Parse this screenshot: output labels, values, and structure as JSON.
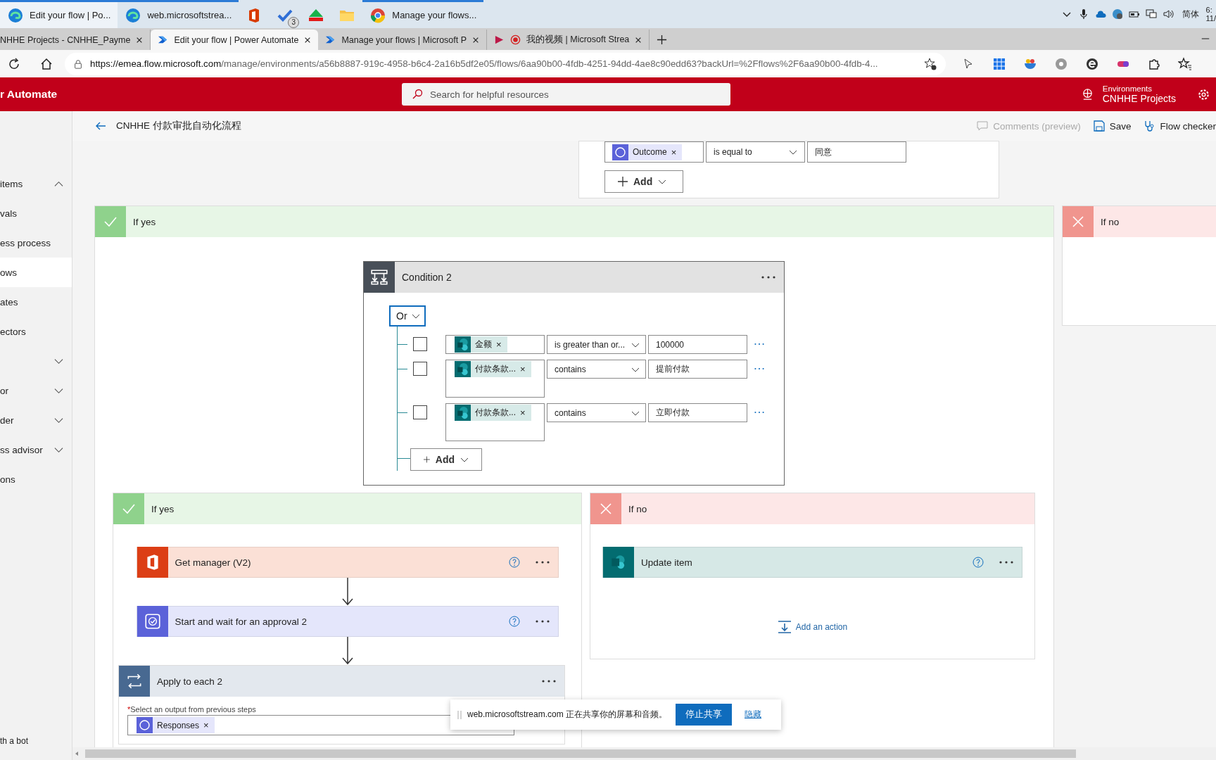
{
  "taskbar": {
    "windows": [
      {
        "kind": "edge",
        "label": "Edit your flow | Po...",
        "open": true,
        "active": true
      },
      {
        "kind": "edge",
        "label": "web.microsoftstrea...",
        "open": true,
        "active": false
      },
      {
        "kind": "office",
        "open": false,
        "active": false
      },
      {
        "kind": "todo",
        "badge": "3",
        "open": false,
        "active": false
      },
      {
        "kind": "triangle",
        "open": false,
        "active": false
      },
      {
        "kind": "folder",
        "open": false,
        "active": false
      },
      {
        "kind": "chrome",
        "label": "Manage your flows...",
        "open": true,
        "active": false
      }
    ],
    "ime": "简体",
    "clock_time": "6:",
    "clock_date": "11/"
  },
  "browser": {
    "tabs": [
      {
        "title": "NHHE Projects - CNHHE_Payme",
        "kind": "plain",
        "selected": false
      },
      {
        "title": "Edit your flow | Power Automate",
        "kind": "automate",
        "selected": true
      },
      {
        "title": "Manage your flows | Microsoft P",
        "kind": "automate",
        "selected": false
      },
      {
        "title": "我的视频 | Microsoft Strea",
        "kind": "stream",
        "selected": false
      }
    ],
    "url_host": "https://emea.flow.microsoft.com",
    "url_path": "/manage/environments/a56b8887-919c-4958-b6c4-2a16b5df2e05/flows/6aa90b00-4fdb-4251-94dd-4ae8c90edd63?backUrl=%2Fflows%2F6aa90b00-4fdb-4..."
  },
  "app_header": {
    "app_name": "r Automate",
    "search": {
      "placeholder": "Search for helpful resources"
    },
    "environment_label": "Environments",
    "environment_name": "CNHHE Projects"
  },
  "flow_header": {
    "title": "CNHHE 付款审批自动化流程",
    "actions": [
      {
        "kind": "comments",
        "label": "Comments (preview)",
        "disabled": true
      },
      {
        "kind": "save",
        "label": "Save",
        "disabled": false
      },
      {
        "kind": "checker",
        "label": "Flow checker",
        "disabled": false
      }
    ]
  },
  "sidebar": {
    "items": [
      {
        "label": "items",
        "expanded": true,
        "selected": false
      },
      {
        "label": "vals",
        "selected": false
      },
      {
        "label": "ess process",
        "selected": false
      },
      {
        "label": "ows",
        "selected": true
      },
      {
        "label": "ates",
        "selected": false
      },
      {
        "label": "ectors",
        "selected": false
      },
      {
        "expanded": false,
        "selected": false
      },
      {
        "label": "or",
        "expanded": false,
        "selected": false
      },
      {
        "label": "der",
        "expanded": false,
        "selected": false
      },
      {
        "label": "ss advisor",
        "expanded": false,
        "selected": false
      },
      {
        "label": "ons",
        "selected": false
      }
    ],
    "footer": "th a bot"
  },
  "canvas": {
    "top_condition": {
      "token": "Outcome",
      "remove": "×",
      "operator": "is equal to",
      "value": "同意",
      "add": "Add"
    },
    "if_yes": {
      "label": "If yes",
      "condition": {
        "title": "Condition 2",
        "group_operator": "Or",
        "rows": [
          {
            "token": "金额",
            "remove": "×",
            "operator": "is greater than or...",
            "value": "100000",
            "checked": false
          },
          {
            "token": "付款条款...",
            "remove": "×",
            "operator": "contains",
            "value": "提前付款",
            "checked": false
          },
          {
            "token": "付款条款...",
            "remove": "×",
            "operator": "contains",
            "value": "立即付款",
            "checked": false
          }
        ],
        "add": "Add"
      },
      "if_yes": {
        "label": "If yes",
        "actions": [
          {
            "kind": "office",
            "title": "Get manager (V2)"
          },
          {
            "kind": "approval",
            "title": "Start and wait for an approval 2"
          }
        ],
        "loop": {
          "title": "Apply to each 2",
          "required_mark": "*",
          "field_label": "Select an output from previous steps",
          "token": "Responses",
          "remove": "×"
        }
      },
      "if_no": {
        "label": "If no",
        "actions": [
          {
            "kind": "sharepoint",
            "title": "Update item"
          }
        ],
        "add_action": "Add an action"
      }
    },
    "if_no": {
      "label": "If no"
    }
  },
  "share_banner": {
    "text": "web.microsoftstream.com 正在共享你的屏幕和音频。",
    "stop": "停止共享",
    "hide": "隐藏"
  }
}
